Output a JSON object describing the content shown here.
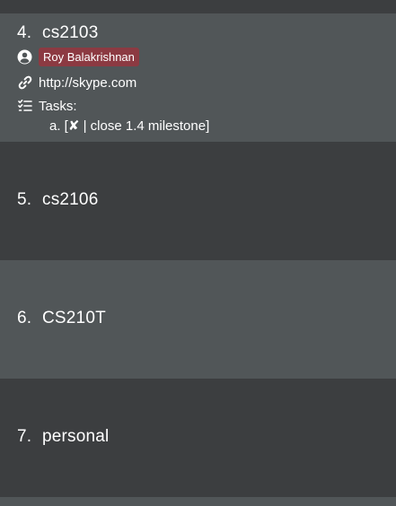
{
  "modules": [
    {
      "index": "4.",
      "code": "cs2103",
      "person_tag": "Roy Balakrishnan",
      "link": "http://skype.com",
      "tasks_label": "Tasks:",
      "tasks": [
        {
          "marker": "a. [",
          "status": "✘",
          "text": " | close 1.4 milestone]"
        }
      ]
    },
    {
      "index": "5.",
      "code": "cs2106"
    },
    {
      "index": "6.",
      "code": "CS210T"
    },
    {
      "index": "7.",
      "code": "personal"
    }
  ],
  "icons": {
    "person": "person-circle-icon",
    "link": "link-icon",
    "tasks": "task-list-icon"
  },
  "colors": {
    "row_dark": "#3c3e40",
    "row_light": "#515658",
    "tag_background": "#8c3a42",
    "text": "#ffffff"
  }
}
